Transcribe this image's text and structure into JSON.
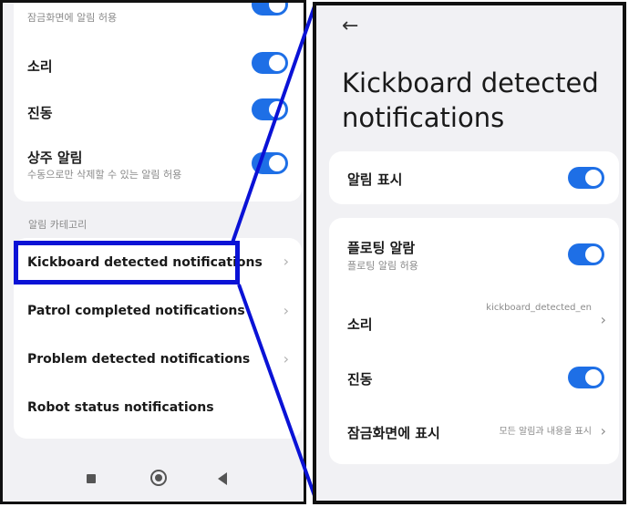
{
  "left": {
    "top_card": {
      "lockscreen_subtitle": "잠금화면에 알림 허용",
      "sound_label": "소리",
      "vibration_label": "진동",
      "persistent_label": "상주 알림",
      "persistent_subtitle": "수동으로만 삭제할 수 있는 알림 허용"
    },
    "section_label": "알림 카테고리",
    "categories": [
      {
        "label": "Kickboard detected notifications"
      },
      {
        "label": "Patrol completed notifications"
      },
      {
        "label": "Problem detected notifications"
      },
      {
        "label": "Robot status notifications"
      }
    ],
    "chevron": "›"
  },
  "right": {
    "back_arrow": "←",
    "title": "Kickboard detected notifications",
    "show_notifications_label": "알림 표시",
    "floating_label": "플로팅 알람",
    "floating_subtitle": "플로팅 알림 허용",
    "sound_label": "소리",
    "sound_value": "kickboard_detected_en",
    "vibration_label": "진동",
    "lockscreen_label": "잠금화면에 표시",
    "lockscreen_value": "모든 알림과 내용을 표시",
    "chevron": "›"
  },
  "colors": {
    "toggle_on": "#1e6fe6",
    "highlight": "#0a12d6",
    "background": "#f1f1f4"
  },
  "toggles": {
    "left_lockscreen": true,
    "left_sound": true,
    "left_vibration": true,
    "left_persistent": true,
    "right_show": true,
    "right_floating": true,
    "right_vibration": true
  },
  "icons": [
    "back-arrow-icon",
    "chevron-right-icon",
    "nav-recents-icon",
    "nav-home-icon",
    "nav-back-icon"
  ]
}
